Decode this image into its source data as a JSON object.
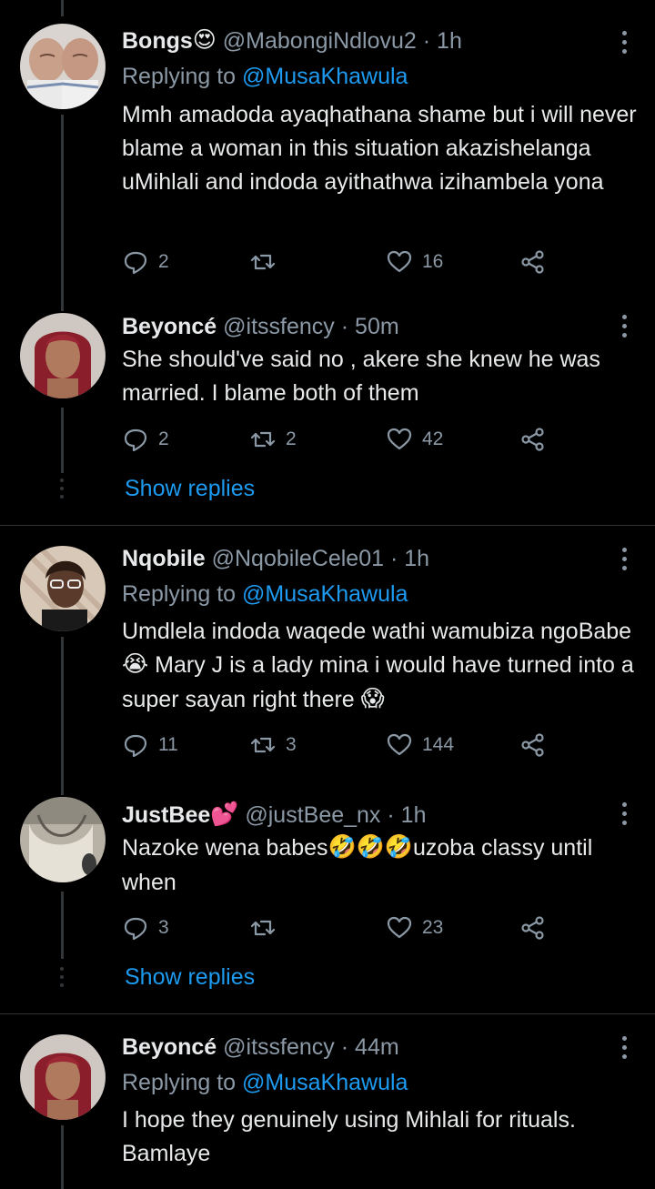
{
  "tweets": [
    {
      "name": "Bongs",
      "name_emoji": "😍",
      "handle": "@MabongiNdlovu2",
      "time": "· 1h",
      "replying_label": "Replying to",
      "replying_handle": "@MusaKhawula",
      "text": "Mmh amadoda ayaqhathana shame but i will never blame a woman in this situation akazishelanga uMihlali and indoda ayithathwa izihambela yona",
      "replies": "2",
      "retweets": "",
      "likes": "16"
    },
    {
      "name": "Beyoncé",
      "handle": "@itssfency",
      "time": "· 50m",
      "text": "She should've said no , akere she knew he was married. I blame both of them",
      "replies": "2",
      "retweets": "2",
      "likes": "42",
      "show_replies": "Show replies"
    },
    {
      "name": "Nqobile",
      "handle": "@NqobileCele01",
      "time": "· 1h",
      "replying_label": "Replying to",
      "replying_handle": "@MusaKhawula",
      "text_parts": [
        "Umdlela indoda waqede wathi wamubiza ngoBabe ",
        "😭",
        " Mary J is a lady mina i would have turned into a super sayan right there ",
        "😱"
      ],
      "replies": "11",
      "retweets": "3",
      "likes": "144"
    },
    {
      "name": "JustBee",
      "name_emoji": "💕",
      "handle": "@justBee_nx",
      "time": "· 1h",
      "text_parts": [
        "Nazoke wena babes",
        "🤣🤣🤣",
        "uzoba classy until when"
      ],
      "replies": "3",
      "retweets": "",
      "likes": "23",
      "show_replies": "Show replies"
    },
    {
      "name": "Beyoncé",
      "handle": "@itssfency",
      "time": "· 44m",
      "replying_label": "Replying to",
      "replying_handle": "@MusaKhawula",
      "text": "I hope they genuinely using Mihlali for rituals. Bamlaye"
    }
  ],
  "colors": {
    "background": "#000000",
    "text": "#e7e9ea",
    "muted": "#8b98a5",
    "link": "#1d9bf0",
    "divider": "#2f3336"
  },
  "icons": [
    "reply-icon",
    "retweet-icon",
    "like-icon",
    "share-icon",
    "more-icon"
  ]
}
